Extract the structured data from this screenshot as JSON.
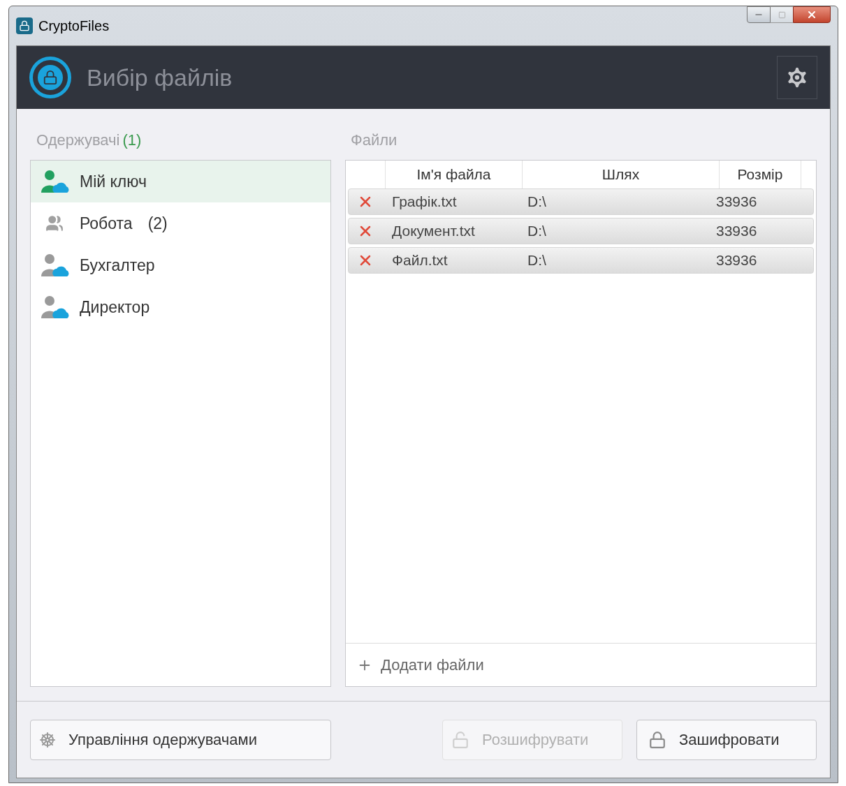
{
  "window": {
    "title": "CryptoFiles"
  },
  "header": {
    "title": "Вибір файлів"
  },
  "recipients": {
    "label": "Одержувачі",
    "count": "(1)",
    "items": [
      {
        "name": "Мій ключ",
        "kind": "user",
        "selected": true
      },
      {
        "name": "Робота",
        "count": "(2)",
        "kind": "group",
        "selected": false
      },
      {
        "name": "Бухгалтер",
        "kind": "user",
        "selected": false
      },
      {
        "name": "Директор",
        "kind": "user",
        "selected": false
      }
    ]
  },
  "files": {
    "label": "Файли",
    "columns": [
      "Ім'я файла",
      "Шлях",
      "Розмір"
    ],
    "rows": [
      {
        "name": "Графік.txt",
        "path": "D:\\",
        "size": "33936"
      },
      {
        "name": "Документ.txt",
        "path": "D:\\",
        "size": "33936"
      },
      {
        "name": "Файл.txt",
        "path": "D:\\",
        "size": "33936"
      }
    ],
    "add_button": "Додати файли"
  },
  "buttons": [
    {
      "label": "Управління одержувачами",
      "kind": "manage",
      "disabled": false
    },
    {
      "label": "Розшифрувати",
      "kind": "decrypt",
      "disabled": true
    },
    {
      "label": "Зашифровати",
      "kind": "encrypt",
      "disabled": false
    }
  ]
}
